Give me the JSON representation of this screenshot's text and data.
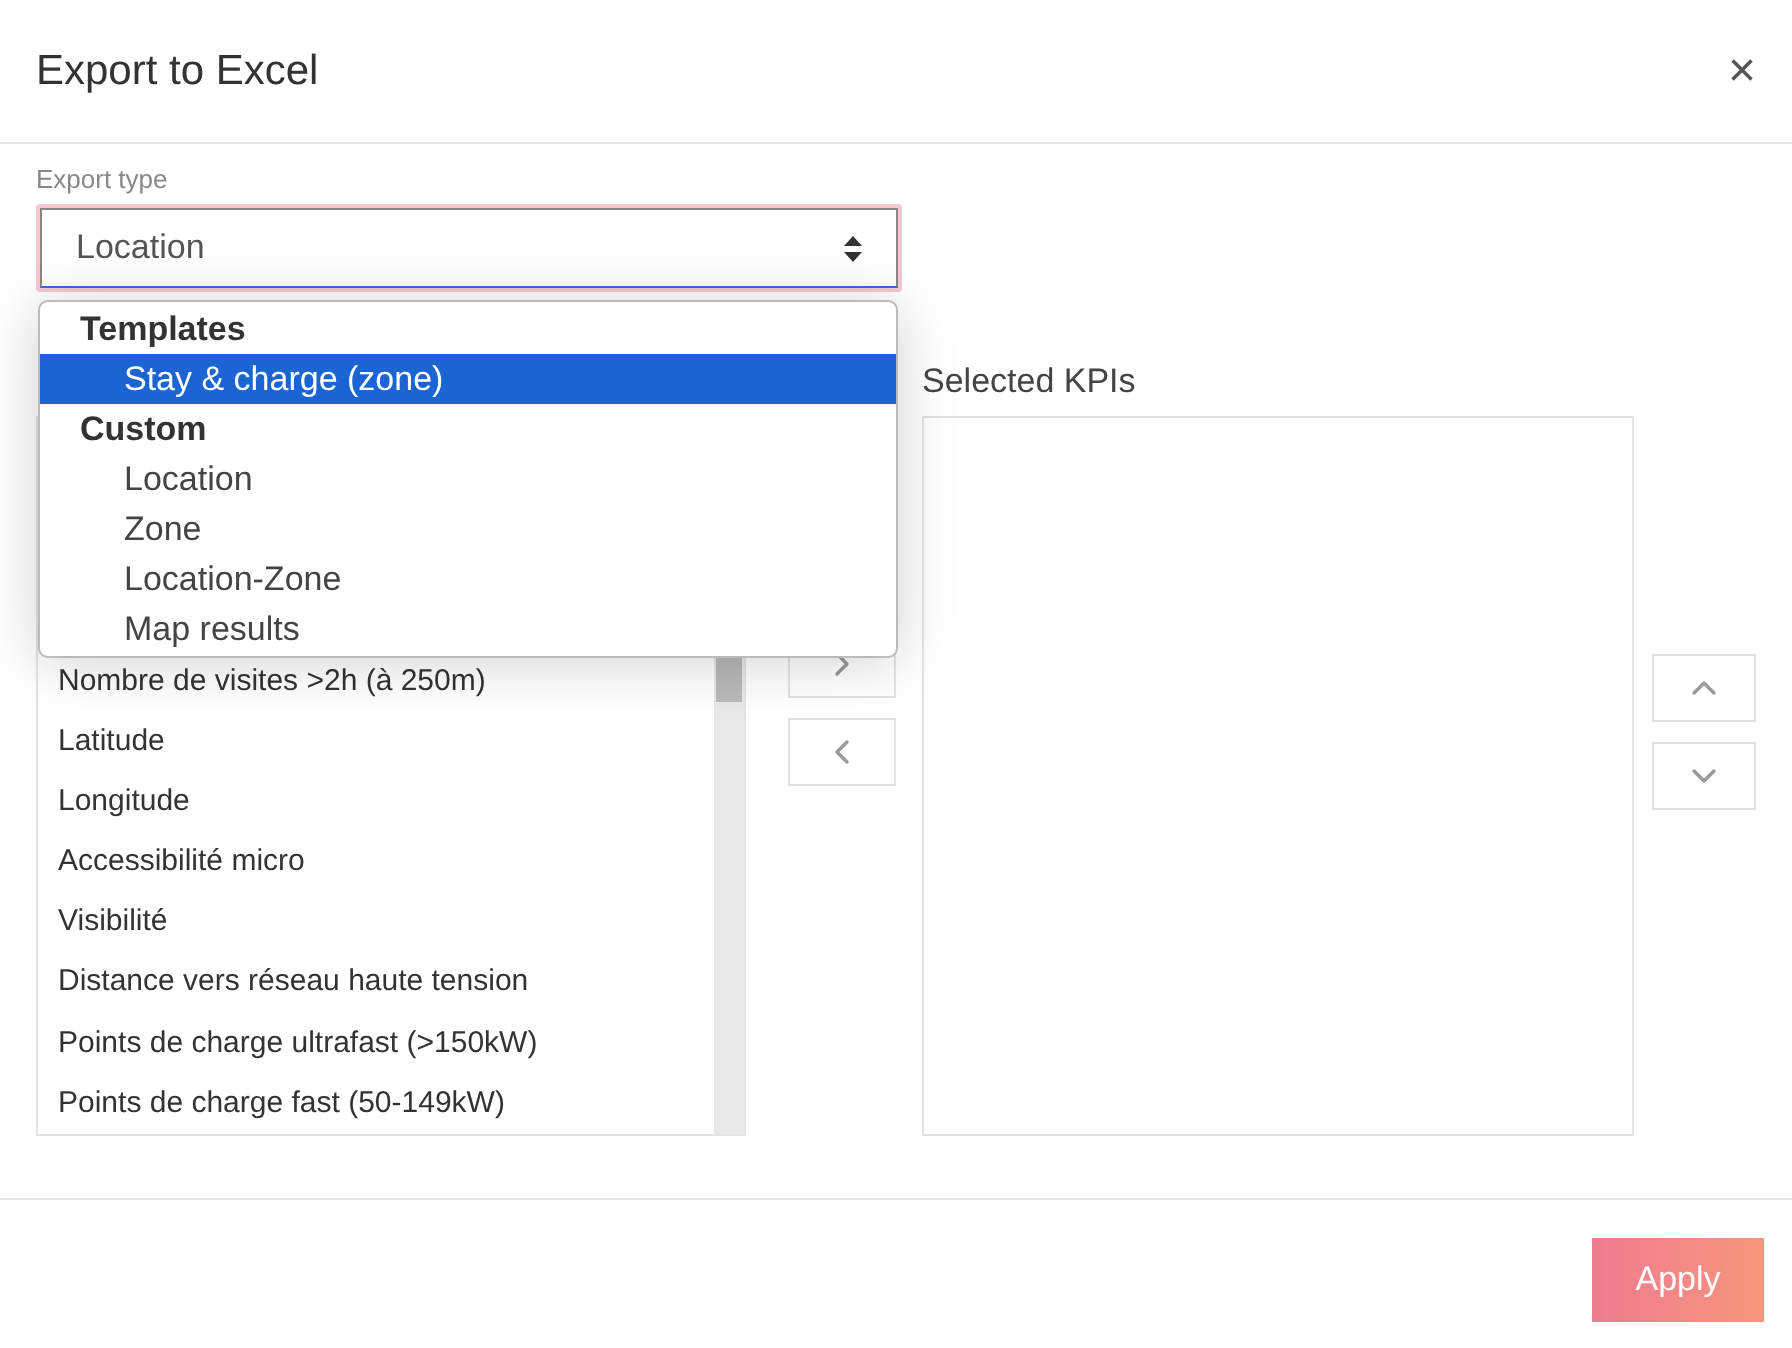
{
  "dialog": {
    "title": "Export to Excel",
    "close": "×"
  },
  "export_type": {
    "label": "Export type",
    "value": "Location",
    "open": true
  },
  "dropdown": {
    "groups": [
      {
        "label": "Templates",
        "options": [
          {
            "label": "Stay & charge (zone)",
            "selected": true
          }
        ]
      },
      {
        "label": "Custom",
        "options": [
          {
            "label": "Location",
            "selected": false
          },
          {
            "label": "Zone",
            "selected": false
          },
          {
            "label": "Location-Zone",
            "selected": false
          },
          {
            "label": "Map results",
            "selected": false
          }
        ]
      }
    ]
  },
  "available_kpis": [
    "Nombre de visites >2h (à 250m)",
    "Latitude",
    "Longitude",
    "Accessibilité micro",
    "Visibilité",
    "Distance vers réseau haute tension",
    "Points de charge ultrafast (>150kW)",
    "Points de charge fast (50-149kW)"
  ],
  "selected_kpis": {
    "title": "Selected KPIs"
  },
  "apply_button": "Apply"
}
